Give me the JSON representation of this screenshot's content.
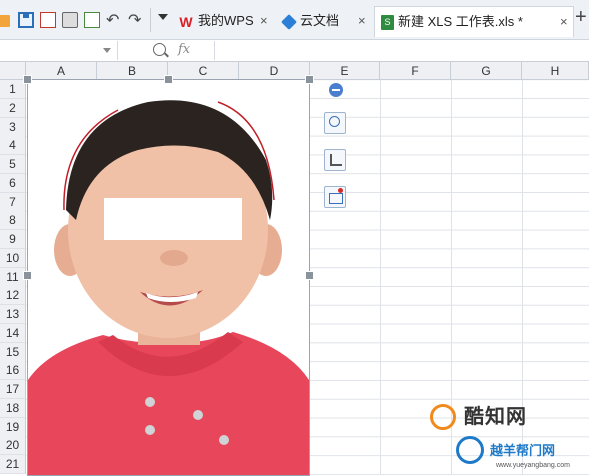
{
  "toolbar": {
    "quick_icons": [
      "folder-open-icon",
      "save-icon",
      "export-pdf-icon",
      "print-icon",
      "print-preview-icon",
      "undo-icon",
      "redo-icon"
    ],
    "undo_glyph": "↶",
    "redo_glyph": "↷"
  },
  "tabs": [
    {
      "label": "我的WPS",
      "icon": "wps-logo-icon"
    },
    {
      "label": "云文档",
      "icon": "cloud-docs-icon"
    },
    {
      "label": "新建 XLS 工作表.xls *",
      "icon": "xls-file-icon",
      "active": true
    }
  ],
  "tab_close_glyph": "×",
  "new_tab_glyph": "+",
  "wps_glyph": "W",
  "file_glyph": "S",
  "formula_bar": {
    "fx_label": "fx",
    "name_box_value": "",
    "formula_value": ""
  },
  "columns": [
    "A",
    "B",
    "C",
    "D",
    "E",
    "F",
    "G",
    "H"
  ],
  "rows": [
    "1",
    "2",
    "3",
    "4",
    "5",
    "6",
    "7",
    "8",
    "9",
    "10",
    "11",
    "12",
    "13",
    "14",
    "15",
    "16",
    "17",
    "18",
    "19",
    "20",
    "21"
  ],
  "picture_tools": [
    "collapse-icon",
    "zoom-in-icon",
    "crop-icon",
    "picture-frame-icon"
  ],
  "watermark": {
    "main": "酷知网",
    "sub": "越羊帮门网",
    "url": "www.yueyangbang.com"
  },
  "colors": {
    "accent_active_tab": "#ffffff",
    "shirt": "#e8465a",
    "wps_red": "#d71f26",
    "xls_green": "#2f8b3f"
  }
}
